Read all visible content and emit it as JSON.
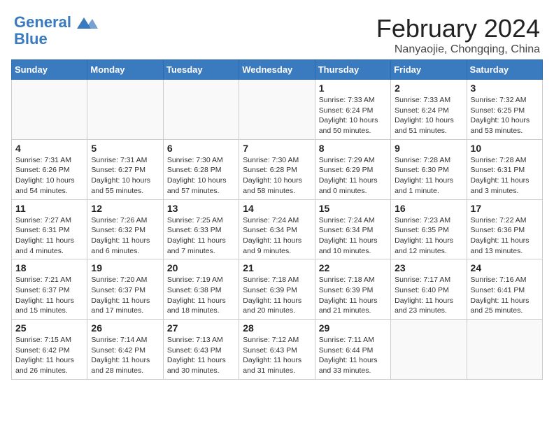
{
  "header": {
    "logo_line1": "General",
    "logo_line2": "Blue",
    "month_year": "February 2024",
    "location": "Nanyaojie, Chongqing, China"
  },
  "days_of_week": [
    "Sunday",
    "Monday",
    "Tuesday",
    "Wednesday",
    "Thursday",
    "Friday",
    "Saturday"
  ],
  "weeks": [
    [
      {
        "day": "",
        "info": ""
      },
      {
        "day": "",
        "info": ""
      },
      {
        "day": "",
        "info": ""
      },
      {
        "day": "",
        "info": ""
      },
      {
        "day": "1",
        "info": "Sunrise: 7:33 AM\nSunset: 6:24 PM\nDaylight: 10 hours\nand 50 minutes."
      },
      {
        "day": "2",
        "info": "Sunrise: 7:33 AM\nSunset: 6:24 PM\nDaylight: 10 hours\nand 51 minutes."
      },
      {
        "day": "3",
        "info": "Sunrise: 7:32 AM\nSunset: 6:25 PM\nDaylight: 10 hours\nand 53 minutes."
      }
    ],
    [
      {
        "day": "4",
        "info": "Sunrise: 7:31 AM\nSunset: 6:26 PM\nDaylight: 10 hours\nand 54 minutes."
      },
      {
        "day": "5",
        "info": "Sunrise: 7:31 AM\nSunset: 6:27 PM\nDaylight: 10 hours\nand 55 minutes."
      },
      {
        "day": "6",
        "info": "Sunrise: 7:30 AM\nSunset: 6:28 PM\nDaylight: 10 hours\nand 57 minutes."
      },
      {
        "day": "7",
        "info": "Sunrise: 7:30 AM\nSunset: 6:28 PM\nDaylight: 10 hours\nand 58 minutes."
      },
      {
        "day": "8",
        "info": "Sunrise: 7:29 AM\nSunset: 6:29 PM\nDaylight: 11 hours\nand 0 minutes."
      },
      {
        "day": "9",
        "info": "Sunrise: 7:28 AM\nSunset: 6:30 PM\nDaylight: 11 hours\nand 1 minute."
      },
      {
        "day": "10",
        "info": "Sunrise: 7:28 AM\nSunset: 6:31 PM\nDaylight: 11 hours\nand 3 minutes."
      }
    ],
    [
      {
        "day": "11",
        "info": "Sunrise: 7:27 AM\nSunset: 6:31 PM\nDaylight: 11 hours\nand 4 minutes."
      },
      {
        "day": "12",
        "info": "Sunrise: 7:26 AM\nSunset: 6:32 PM\nDaylight: 11 hours\nand 6 minutes."
      },
      {
        "day": "13",
        "info": "Sunrise: 7:25 AM\nSunset: 6:33 PM\nDaylight: 11 hours\nand 7 minutes."
      },
      {
        "day": "14",
        "info": "Sunrise: 7:24 AM\nSunset: 6:34 PM\nDaylight: 11 hours\nand 9 minutes."
      },
      {
        "day": "15",
        "info": "Sunrise: 7:24 AM\nSunset: 6:34 PM\nDaylight: 11 hours\nand 10 minutes."
      },
      {
        "day": "16",
        "info": "Sunrise: 7:23 AM\nSunset: 6:35 PM\nDaylight: 11 hours\nand 12 minutes."
      },
      {
        "day": "17",
        "info": "Sunrise: 7:22 AM\nSunset: 6:36 PM\nDaylight: 11 hours\nand 13 minutes."
      }
    ],
    [
      {
        "day": "18",
        "info": "Sunrise: 7:21 AM\nSunset: 6:37 PM\nDaylight: 11 hours\nand 15 minutes."
      },
      {
        "day": "19",
        "info": "Sunrise: 7:20 AM\nSunset: 6:37 PM\nDaylight: 11 hours\nand 17 minutes."
      },
      {
        "day": "20",
        "info": "Sunrise: 7:19 AM\nSunset: 6:38 PM\nDaylight: 11 hours\nand 18 minutes."
      },
      {
        "day": "21",
        "info": "Sunrise: 7:18 AM\nSunset: 6:39 PM\nDaylight: 11 hours\nand 20 minutes."
      },
      {
        "day": "22",
        "info": "Sunrise: 7:18 AM\nSunset: 6:39 PM\nDaylight: 11 hours\nand 21 minutes."
      },
      {
        "day": "23",
        "info": "Sunrise: 7:17 AM\nSunset: 6:40 PM\nDaylight: 11 hours\nand 23 minutes."
      },
      {
        "day": "24",
        "info": "Sunrise: 7:16 AM\nSunset: 6:41 PM\nDaylight: 11 hours\nand 25 minutes."
      }
    ],
    [
      {
        "day": "25",
        "info": "Sunrise: 7:15 AM\nSunset: 6:42 PM\nDaylight: 11 hours\nand 26 minutes."
      },
      {
        "day": "26",
        "info": "Sunrise: 7:14 AM\nSunset: 6:42 PM\nDaylight: 11 hours\nand 28 minutes."
      },
      {
        "day": "27",
        "info": "Sunrise: 7:13 AM\nSunset: 6:43 PM\nDaylight: 11 hours\nand 30 minutes."
      },
      {
        "day": "28",
        "info": "Sunrise: 7:12 AM\nSunset: 6:43 PM\nDaylight: 11 hours\nand 31 minutes."
      },
      {
        "day": "29",
        "info": "Sunrise: 7:11 AM\nSunset: 6:44 PM\nDaylight: 11 hours\nand 33 minutes."
      },
      {
        "day": "",
        "info": ""
      },
      {
        "day": "",
        "info": ""
      }
    ]
  ]
}
